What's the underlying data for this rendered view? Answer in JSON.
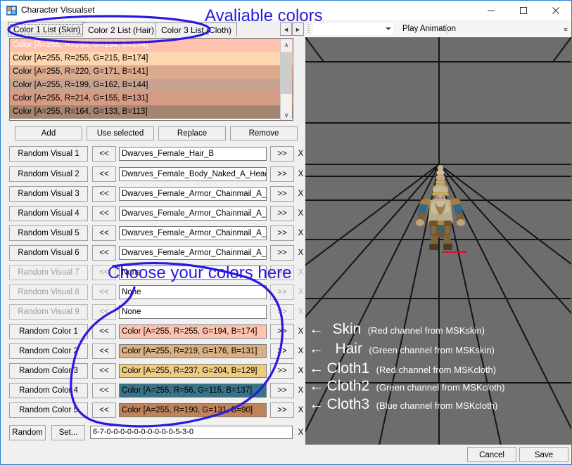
{
  "window": {
    "title": "Character Visualset",
    "icon": "app-window-icon",
    "controls": {
      "minimize": "minimize-icon",
      "maximize": "maximize-icon",
      "close": "close-icon"
    }
  },
  "tabs": {
    "items": [
      {
        "label": "Color 1 List (Skin)",
        "selected": true
      },
      {
        "label": "Color 2 List (Hair)",
        "selected": false
      },
      {
        "label": "Color 3 List (Cloth)",
        "selected": false
      }
    ],
    "scroll_left": "◄",
    "scroll_right": "►"
  },
  "color_list": {
    "scrollbar": {
      "up": "∧",
      "down": "∨"
    },
    "rows": [
      {
        "label": "Color [A=255, R=255, G=194, B=174]",
        "swatch": "#FFC2AE",
        "selected": true
      },
      {
        "label": "Color [A=255, R=255, G=215, B=174]",
        "swatch": "#FFD7AE",
        "selected": false
      },
      {
        "label": "Color [A=255, R=220, G=171, B=141]",
        "swatch": "#DCAB8D",
        "selected": false
      },
      {
        "label": "Color [A=255, R=199, G=162, B=144]",
        "swatch": "#C7A290",
        "selected": false
      },
      {
        "label": "Color [A=255, R=214, G=155, B=131]",
        "swatch": "#D69B83",
        "selected": false
      },
      {
        "label": "Color [A=255, R=164, G=133, B=113]",
        "swatch": "#A48571",
        "selected": false
      }
    ]
  },
  "list_actions": [
    {
      "label": "Add"
    },
    {
      "label": "Use selected"
    },
    {
      "label": "Replace"
    },
    {
      "label": "Remove"
    }
  ],
  "visual_rows": [
    {
      "label": "Random Visual 1",
      "value": "Dwarves_Female_Hair_B",
      "disabled": false
    },
    {
      "label": "Random Visual 2",
      "value": "Dwarves_Female_Body_Naked_A_Head_H",
      "disabled": false
    },
    {
      "label": "Random Visual 3",
      "value": "Dwarves_Female_Armor_Chainmail_A_Upperbody",
      "disabled": false
    },
    {
      "label": "Random Visual 4",
      "value": "Dwarves_Female_Armor_Chainmail_A_Arms_A",
      "disabled": false
    },
    {
      "label": "Random Visual 5",
      "value": "Dwarves_Female_Armor_Chainmail_A_Lowerbody",
      "disabled": false
    },
    {
      "label": "Random Visual 6",
      "value": "Dwarves_Female_Armor_Chainmail_A_Legs_A",
      "disabled": false
    },
    {
      "label": "Random Visual 7",
      "value": "None",
      "disabled": true
    },
    {
      "label": "Random Visual 8",
      "value": "None",
      "disabled": true
    },
    {
      "label": "Random Visual 9",
      "value": "None",
      "disabled": true
    }
  ],
  "color_rows": [
    {
      "label": "Random Color 1",
      "value": "Color [A=255, R=255, G=194, B=174]",
      "swatch": "#FFC2AE",
      "selected": false
    },
    {
      "label": "Random Color 2",
      "value": "Color [A=255, R=219, G=176, B=131]",
      "swatch": "#DBB083",
      "selected": false
    },
    {
      "label": "Random Color 3",
      "value": "Color [A=255, R=237, G=204, B=129]",
      "swatch": "#EDCC81",
      "selected": false
    },
    {
      "label": "Random Color 4",
      "value": "Color [A=255, R=56, G=115, B=137]",
      "swatch": "#387389",
      "selected": true
    },
    {
      "label": "Random Color 5",
      "value": "Color [A=255, R=190, G=131, B=90]",
      "swatch": "#BE835A",
      "selected": false
    }
  ],
  "row_buttons": {
    "prev": "<<",
    "next": ">>",
    "delete": "X"
  },
  "bottom_bar": {
    "random_label": "Random",
    "set_label": "Set...",
    "code_value": "6-7-0-0-0-0-0-0-0-0-0-0-5-3-0",
    "delete": "X"
  },
  "viewport_toolbar": {
    "combo_value": "",
    "play_label": "Play Animation",
    "overflow": "≡"
  },
  "footer": {
    "cancel_label": "Cancel",
    "save_label": "Save"
  },
  "annotations": {
    "top": "Avaliable colors",
    "middle": "Choose your colors here",
    "channels": [
      {
        "arrow": "←",
        "name": "Skin",
        "desc": "(Red channel from MSKskin)"
      },
      {
        "arrow": "←",
        "name": "Hair",
        "desc": "(Green channel from MSKskin)"
      },
      {
        "arrow": "←",
        "name": "Cloth1",
        "desc": "(Red channel from MSKcloth)"
      },
      {
        "arrow": "←",
        "name": "Cloth2",
        "desc": "(Green channel from MSKcloth)"
      },
      {
        "arrow": "←",
        "name": "Cloth3",
        "desc": "(Blue channel from MSKcloth)"
      }
    ],
    "ink_color": "#2a1ae0"
  },
  "colors": {
    "window_bg": "#f0f0f0",
    "viewport_bg": "#6d6d6d",
    "accent_border": "#2a7cd1",
    "grid_line": "#141414"
  }
}
